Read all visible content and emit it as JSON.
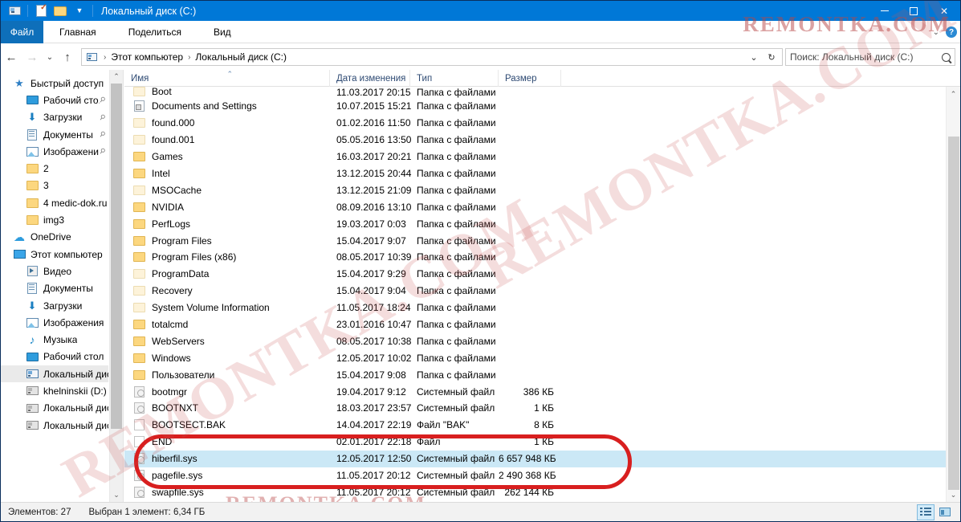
{
  "window": {
    "title": "Локальный диск (C:)",
    "quick_access": [
      "drive-icon",
      "properties-icon",
      "new-folder-icon"
    ],
    "controls": {
      "minimize": "—",
      "maximize": "□",
      "close": "✕"
    }
  },
  "ribbon": {
    "file_tab": "Файл",
    "tabs": [
      "Главная",
      "Поделиться",
      "Вид"
    ],
    "expand": "chevron-down-icon",
    "help": "?"
  },
  "address": {
    "back": "←",
    "forward": "→",
    "history": "⌄",
    "up": "↑",
    "crumbs": [
      "Этот компьютер",
      "Локальный диск (C:)"
    ],
    "dropdown": "⌄",
    "refresh": "↻",
    "search_placeholder": "Поиск: Локальный диск (C:)"
  },
  "sidebar": {
    "items": [
      {
        "label": "Быстрый доступ",
        "icon": "star-icon",
        "indent": 0,
        "pinned": false,
        "selected": false
      },
      {
        "label": "Рабочий сто.",
        "icon": "desktop-icon",
        "indent": 1,
        "pinned": true,
        "selected": false
      },
      {
        "label": "Загрузки",
        "icon": "download-icon",
        "indent": 1,
        "pinned": true,
        "selected": false
      },
      {
        "label": "Документы",
        "icon": "document-icon",
        "indent": 1,
        "pinned": true,
        "selected": false
      },
      {
        "label": "Изображени",
        "icon": "picture-icon",
        "indent": 1,
        "pinned": true,
        "selected": false
      },
      {
        "label": "2",
        "icon": "folder-icon",
        "indent": 1,
        "pinned": false,
        "selected": false
      },
      {
        "label": "3",
        "icon": "folder-icon",
        "indent": 1,
        "pinned": false,
        "selected": false
      },
      {
        "label": "4 medic-dok.ru",
        "icon": "folder-icon",
        "indent": 1,
        "pinned": false,
        "selected": false
      },
      {
        "label": "img3",
        "icon": "folder-icon",
        "indent": 1,
        "pinned": false,
        "selected": false
      },
      {
        "label": "OneDrive",
        "icon": "cloud-icon",
        "indent": 0,
        "pinned": false,
        "selected": false
      },
      {
        "label": "Этот компьютер",
        "icon": "computer-icon",
        "indent": 0,
        "pinned": false,
        "selected": false
      },
      {
        "label": "Видео",
        "icon": "video-icon",
        "indent": 1,
        "pinned": false,
        "selected": false
      },
      {
        "label": "Документы",
        "icon": "document-icon",
        "indent": 1,
        "pinned": false,
        "selected": false
      },
      {
        "label": "Загрузки",
        "icon": "download-icon",
        "indent": 1,
        "pinned": false,
        "selected": false
      },
      {
        "label": "Изображения",
        "icon": "picture-icon",
        "indent": 1,
        "pinned": false,
        "selected": false
      },
      {
        "label": "Музыка",
        "icon": "music-icon",
        "indent": 1,
        "pinned": false,
        "selected": false
      },
      {
        "label": "Рабочий стол",
        "icon": "desktop-icon",
        "indent": 1,
        "pinned": false,
        "selected": false
      },
      {
        "label": "Локальный дис",
        "icon": "harddisk-icon",
        "indent": 1,
        "pinned": false,
        "selected": true
      },
      {
        "label": "khelninskii (D:)",
        "icon": "drive-grey-icon",
        "indent": 1,
        "pinned": false,
        "selected": false
      },
      {
        "label": "Локальный дис",
        "icon": "drive-grey-icon",
        "indent": 1,
        "pinned": false,
        "selected": false
      },
      {
        "label": "Локальный дис",
        "icon": "drive-grey-icon",
        "indent": 1,
        "pinned": false,
        "selected": false
      }
    ]
  },
  "columns": {
    "name": "Имя",
    "date": "Дата изменения",
    "type": "Тип",
    "size": "Размер",
    "sorted_by": "name",
    "sort_mark": "⌃"
  },
  "files": [
    {
      "name": "Boot",
      "date": "11.03.2017 20:15",
      "type": "Папка с файлами",
      "size": "",
      "icon": "folder-pale-icon",
      "selected": false,
      "partial": true
    },
    {
      "name": "Documents and Settings",
      "date": "10.07.2015 15:21",
      "type": "Папка с файлами",
      "size": "",
      "icon": "shortcut-icon",
      "selected": false
    },
    {
      "name": "found.000",
      "date": "01.02.2016 11:50",
      "type": "Папка с файлами",
      "size": "",
      "icon": "folder-pale-icon",
      "selected": false
    },
    {
      "name": "found.001",
      "date": "05.05.2016 13:50",
      "type": "Папка с файлами",
      "size": "",
      "icon": "folder-pale-icon",
      "selected": false
    },
    {
      "name": "Games",
      "date": "16.03.2017 20:21",
      "type": "Папка с файлами",
      "size": "",
      "icon": "folder-icon",
      "selected": false
    },
    {
      "name": "Intel",
      "date": "13.12.2015 20:44",
      "type": "Папка с файлами",
      "size": "",
      "icon": "folder-icon",
      "selected": false
    },
    {
      "name": "MSOCache",
      "date": "13.12.2015 21:09",
      "type": "Папка с файлами",
      "size": "",
      "icon": "folder-pale-icon",
      "selected": false
    },
    {
      "name": "NVIDIA",
      "date": "08.09.2016 13:10",
      "type": "Папка с файлами",
      "size": "",
      "icon": "folder-icon",
      "selected": false
    },
    {
      "name": "PerfLogs",
      "date": "19.03.2017 0:03",
      "type": "Папка с файлами",
      "size": "",
      "icon": "folder-icon",
      "selected": false
    },
    {
      "name": "Program Files",
      "date": "15.04.2017 9:07",
      "type": "Папка с файлами",
      "size": "",
      "icon": "folder-icon",
      "selected": false
    },
    {
      "name": "Program Files (x86)",
      "date": "08.05.2017 10:39",
      "type": "Папка с файлами",
      "size": "",
      "icon": "folder-icon",
      "selected": false
    },
    {
      "name": "ProgramData",
      "date": "15.04.2017 9:29",
      "type": "Папка с файлами",
      "size": "",
      "icon": "folder-pale-icon",
      "selected": false
    },
    {
      "name": "Recovery",
      "date": "15.04.2017 9:04",
      "type": "Папка с файлами",
      "size": "",
      "icon": "folder-pale-icon",
      "selected": false
    },
    {
      "name": "System Volume Information",
      "date": "11.05.2017 18:24",
      "type": "Папка с файлами",
      "size": "",
      "icon": "folder-pale-icon",
      "selected": false
    },
    {
      "name": "totalcmd",
      "date": "23.01.2016 10:47",
      "type": "Папка с файлами",
      "size": "",
      "icon": "folder-icon",
      "selected": false
    },
    {
      "name": "WebServers",
      "date": "08.05.2017 10:38",
      "type": "Папка с файлами",
      "size": "",
      "icon": "folder-icon",
      "selected": false
    },
    {
      "name": "Windows",
      "date": "12.05.2017 10:02",
      "type": "Папка с файлами",
      "size": "",
      "icon": "folder-icon",
      "selected": false
    },
    {
      "name": "Пользователи",
      "date": "15.04.2017 9:08",
      "type": "Папка с файлами",
      "size": "",
      "icon": "folder-icon",
      "selected": false
    },
    {
      "name": "bootmgr",
      "date": "19.04.2017 9:12",
      "type": "Системный файл",
      "size": "386 КБ",
      "icon": "system-file-icon",
      "selected": false
    },
    {
      "name": "BOOTNXT",
      "date": "18.03.2017 23:57",
      "type": "Системный файл",
      "size": "1 КБ",
      "icon": "system-file-icon",
      "selected": false
    },
    {
      "name": "BOOTSECT.BAK",
      "date": "14.04.2017 22:19",
      "type": "Файл \"BAK\"",
      "size": "8 КБ",
      "icon": "blank-file-icon",
      "selected": false
    },
    {
      "name": "END",
      "date": "02.01.2017 22:18",
      "type": "Файл",
      "size": "1 КБ",
      "icon": "blank-file-icon",
      "selected": false
    },
    {
      "name": "hiberfil.sys",
      "date": "12.05.2017 12:50",
      "type": "Системный файл",
      "size": "6 657 948 КБ",
      "icon": "system-file-icon",
      "selected": true
    },
    {
      "name": "pagefile.sys",
      "date": "11.05.2017 20:12",
      "type": "Системный файл",
      "size": "2 490 368 КБ",
      "icon": "system-file-icon",
      "selected": false
    },
    {
      "name": "swapfile.sys",
      "date": "11.05.2017 20:12",
      "type": "Системный файл",
      "size": "262 144 КБ",
      "icon": "system-file-icon",
      "selected": false
    }
  ],
  "status": {
    "count": "Элементов: 27",
    "selection": "Выбран 1 элемент: 6,34 ГБ",
    "view_details": "details-view-icon",
    "view_tiles": "tiles-view-icon"
  },
  "annotation": {
    "shape": "red-ellipse",
    "color": "#d81f1f"
  },
  "watermarks": {
    "top_right": "REMONTKA.COM",
    "center": "REMONTKA.COM",
    "left": "REMONTKA.COM",
    "bottom": "REMONTKA.COM"
  }
}
